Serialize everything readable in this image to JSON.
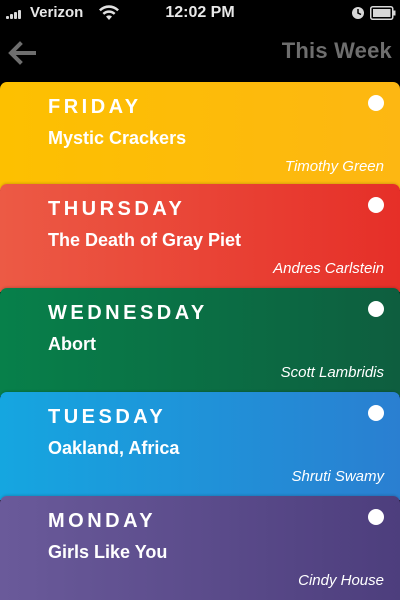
{
  "status_bar": {
    "carrier": "Verizon",
    "time": "12:02 PM",
    "icons": [
      "signal-icon",
      "wifi-icon",
      "alarm-icon",
      "battery-icon"
    ]
  },
  "nav": {
    "back_icon": "back-arrow-icon",
    "title": "This Week"
  },
  "stories": [
    {
      "day": "FRIDAY",
      "title": "Mystic Crackers",
      "author": "Timothy Green",
      "color": "#fdbc00"
    },
    {
      "day": "THURSDAY",
      "title": "The Death of Gray Piet",
      "author": "Andres Carlstein",
      "color": "#e9473a"
    },
    {
      "day": "WEDNESDAY",
      "title": "Abort",
      "author": "Scott Lambridis",
      "color": "#097346"
    },
    {
      "day": "TUESDAY",
      "title": "Oakland, Africa",
      "author": "Shruti Swamy",
      "color": "#1e93da"
    },
    {
      "day": "MONDAY",
      "title": "Girls Like You",
      "author": "Cindy House",
      "color": "#5f4f8f"
    }
  ]
}
